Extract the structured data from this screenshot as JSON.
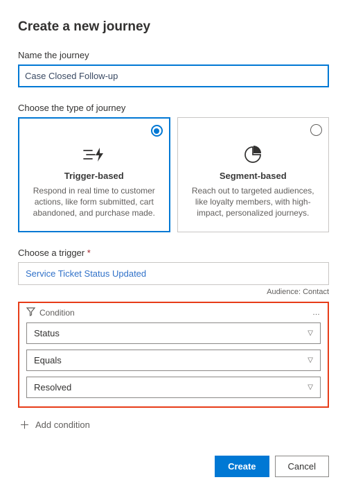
{
  "title": "Create a new journey",
  "name_section": {
    "label": "Name the journey",
    "value": "Case Closed Follow-up"
  },
  "type_section": {
    "label": "Choose the type of journey",
    "cards": [
      {
        "title": "Trigger-based",
        "desc": "Respond in real time to customer actions, like form submitted, cart abandoned, and purchase made.",
        "selected": true
      },
      {
        "title": "Segment-based",
        "desc": "Reach out to targeted audiences, like loyalty members, with high-impact, personalized journeys.",
        "selected": false
      }
    ]
  },
  "trigger_section": {
    "label": "Choose a trigger ",
    "required_marker": "*",
    "value": "Service Ticket Status Updated",
    "audience_label": "Audience: Contact"
  },
  "condition": {
    "header": "Condition",
    "more": "…",
    "field": "Status",
    "operator": "Equals",
    "value": "Resolved"
  },
  "add_condition_label": "Add condition",
  "footer": {
    "create": "Create",
    "cancel": "Cancel"
  }
}
